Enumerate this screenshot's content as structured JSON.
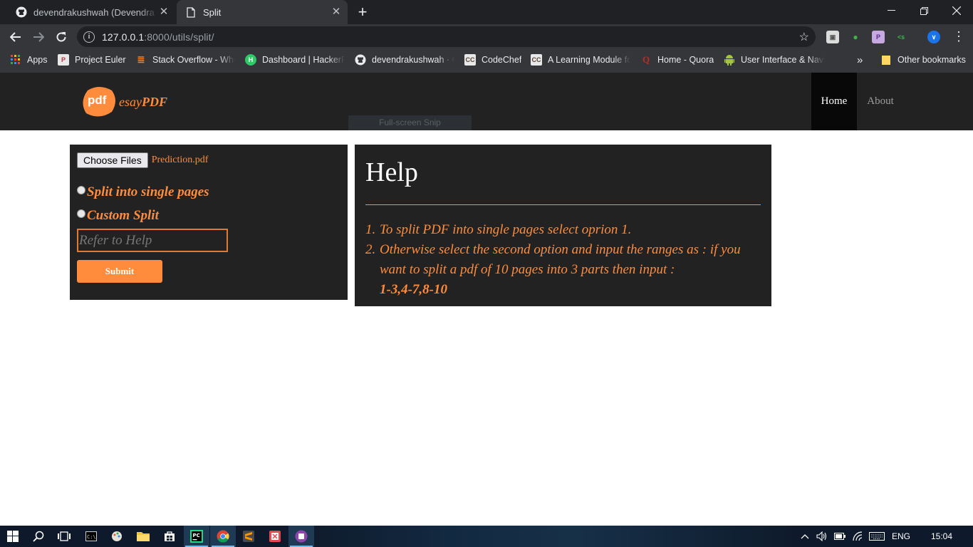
{
  "browser": {
    "tabs": [
      {
        "title": "devendrakushwah (Devendra Kushwah)",
        "icon": "github-icon"
      },
      {
        "title": "Split",
        "icon": "page-icon"
      }
    ],
    "url_host": "127.0.0.1",
    "url_path": ":8000/utils/split/",
    "bookmarks": [
      {
        "label": "Apps",
        "icon": "apps-grid-icon"
      },
      {
        "label": "Project Euler",
        "icon": "project-euler-icon"
      },
      {
        "label": "Stack Overflow - Whe",
        "icon": "stackoverflow-icon"
      },
      {
        "label": "Dashboard | HackerR",
        "icon": "hackerrank-icon"
      },
      {
        "label": "devendrakushwah · G",
        "icon": "github-icon"
      },
      {
        "label": "CodeChef",
        "icon": "codechef-icon"
      },
      {
        "label": "A Learning Module fo",
        "icon": "codechef-icon"
      },
      {
        "label": "Home - Quora",
        "icon": "quora-icon"
      },
      {
        "label": "User Interface & Navi",
        "icon": "android-icon"
      }
    ],
    "bookmarks_overflow": "»",
    "other_bookmarks": "Other bookmarks"
  },
  "site": {
    "logo_badge": "pdf",
    "logo_text_light": "esay",
    "logo_text_bold": "PDF",
    "nav": {
      "home": "Home",
      "about": "About"
    },
    "overlay_snip": "Full-screen Snip"
  },
  "form": {
    "choose_files_label": "Choose Files",
    "selected_file": "Prediction.pdf",
    "option_single": "Split into single pages",
    "option_custom": "Custom Split",
    "range_placeholder": "Refer to Help",
    "submit_label": "Submit"
  },
  "help": {
    "title": "Help",
    "item1_num": "1.",
    "item1": "To split PDF into single pages select oprion 1.",
    "item2_num": "2.",
    "item2": "Otherwise select the second option and input the ranges as : if you want to split a pdf of 10 pages into 3 parts then input :",
    "item2_code": "1-3,4-7,8-10"
  },
  "taskbar": {
    "language": "ENG",
    "time": "15:04"
  },
  "colors": {
    "accent": "#ff8c3c",
    "panel": "#222222",
    "chrome_dark": "#202124",
    "chrome_toolbar": "#35363a"
  }
}
